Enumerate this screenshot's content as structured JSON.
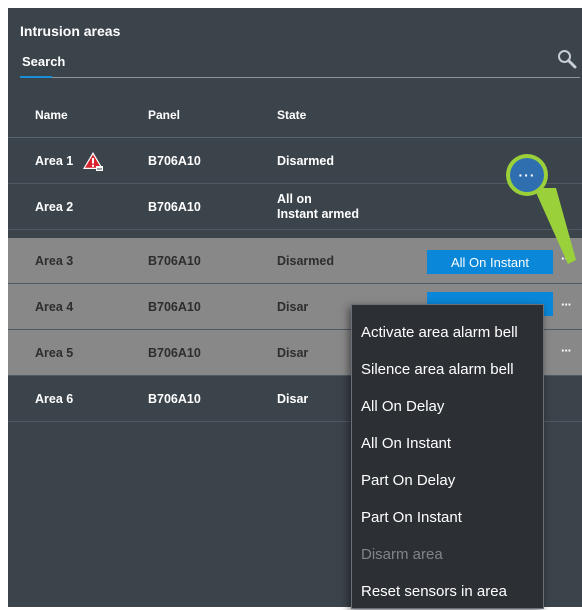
{
  "title": "Intrusion areas",
  "search": {
    "label": "Search"
  },
  "columns": {
    "name": "Name",
    "panel": "Panel",
    "state": "State"
  },
  "rows": [
    {
      "name": "Area 1",
      "panel": "B706A10",
      "state": "Disarmed",
      "warning": true
    },
    {
      "name": "Area 2",
      "panel": "B706A10",
      "state_line1": "All on",
      "state_line2": "Instant armed"
    },
    {
      "name": "Area 3",
      "panel": "B706A10",
      "state": "Disarmed",
      "action": "All On Instant",
      "more": "···"
    },
    {
      "name": "Area 4",
      "panel": "B706A10",
      "state": "Disar",
      "more": "···"
    },
    {
      "name": "Area 5",
      "panel": "B706A10",
      "state": "Disar",
      "more": "···"
    },
    {
      "name": "Area 6",
      "panel": "B706A10",
      "state": "Disar"
    }
  ],
  "callout": {
    "label": "···"
  },
  "menu": {
    "items": [
      {
        "label": "Activate area alarm bell",
        "enabled": true
      },
      {
        "label": "Silence area alarm bell",
        "enabled": true
      },
      {
        "label": "All On Delay",
        "enabled": true
      },
      {
        "label": "All On Instant",
        "enabled": true
      },
      {
        "label": "Part On Delay",
        "enabled": true
      },
      {
        "label": "Part On Instant",
        "enabled": true
      },
      {
        "label": "Disarm area",
        "enabled": false
      },
      {
        "label": "Reset sensors in area",
        "enabled": true
      }
    ]
  },
  "colors": {
    "panel_bg": "#3b434b",
    "selected_row": "#888888",
    "accent_blue": "#0a87d8",
    "callout_green": "#9ad03a",
    "warning_red": "#d9232d",
    "menu_bg": "#2c3035"
  }
}
